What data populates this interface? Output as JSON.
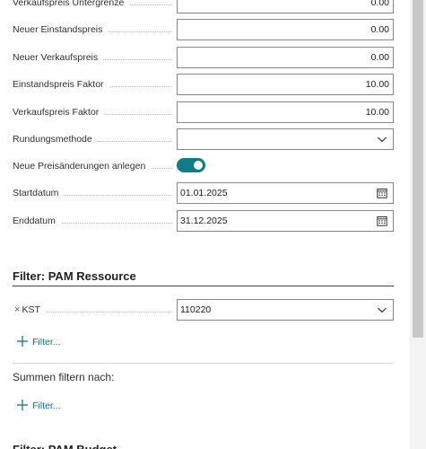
{
  "fields": [
    {
      "label": "Verkaufspreis Untergrenze",
      "value": "0.00"
    },
    {
      "label": "Neuer Einstandspreis",
      "value": "0.00"
    },
    {
      "label": "Neuer Verkaufspreis",
      "value": "0.00"
    },
    {
      "label": "Einstandspreis Faktor",
      "value": "10.00"
    },
    {
      "label": "Verkaufspreis Faktor",
      "value": "10.00"
    }
  ],
  "rundung": {
    "label": "Rundungsmethode",
    "value": ""
  },
  "toggle": {
    "label": "Neue Preisänderungen anlegen",
    "on": true
  },
  "startdatum": {
    "label": "Startdatum",
    "value": "01.01.2025"
  },
  "enddatum": {
    "label": "Enddatum",
    "value": "31.12.2025"
  },
  "filter_ressource": {
    "title": "Filter: PAM Ressource",
    "remove_glyph": "×",
    "field_label": "KST",
    "field_value": "110220",
    "add_filter": "Filter..."
  },
  "summen": {
    "label": "Summen filtern nach:",
    "add_filter": "Filter..."
  },
  "next_section": {
    "title": "Filter: PAM Budget"
  },
  "colors": {
    "accent": "#107c83",
    "link": "#0f6c82",
    "border": "#8a8886"
  }
}
